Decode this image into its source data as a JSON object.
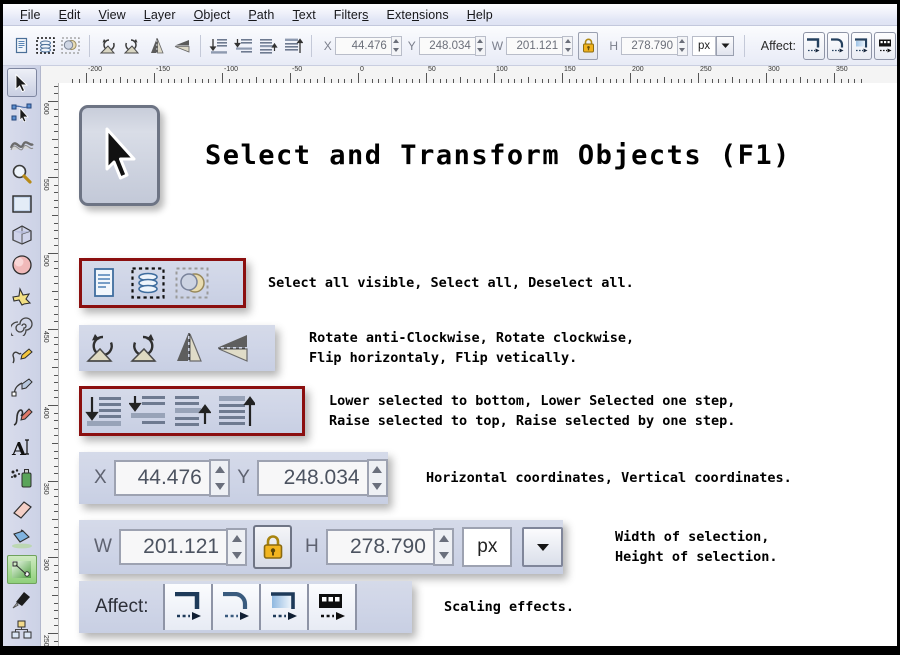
{
  "menu": {
    "items": [
      {
        "label": "File",
        "accel": "F"
      },
      {
        "label": "Edit",
        "accel": "E"
      },
      {
        "label": "View",
        "accel": "V"
      },
      {
        "label": "Layer",
        "accel": "L"
      },
      {
        "label": "Object",
        "accel": "O"
      },
      {
        "label": "Path",
        "accel": "P"
      },
      {
        "label": "Text",
        "accel": "T"
      },
      {
        "label": "Filters",
        "accel": "s"
      },
      {
        "label": "Extensions",
        "accel": "n"
      },
      {
        "label": "Help",
        "accel": "H"
      }
    ]
  },
  "toolbar": {
    "select_all_visible_icon": "document-icon",
    "select_all_icon": "layers-dashed-icon",
    "deselect_all_icon": "deselect-dashed-icon",
    "rotate_ccw_icon": "rotate-counterclockwise-icon",
    "rotate_cw_icon": "rotate-clockwise-icon",
    "flip_h_icon": "flip-horizontal-icon",
    "flip_v_icon": "flip-vertical-icon",
    "lower_to_bottom_icon": "lower-to-bottom-icon",
    "lower_one_icon": "lower-one-step-icon",
    "raise_one_icon": "raise-one-step-icon",
    "raise_to_top_icon": "raise-to-top-icon",
    "x_label": "X",
    "x_value": "44.476",
    "y_label": "Y",
    "y_value": "248.034",
    "w_label": "W",
    "w_value": "201.121",
    "lock_icon": "padlock-icon",
    "h_label": "H",
    "h_value": "278.790",
    "unit_value": "px",
    "unit_dropdown_icon": "chevron-down-icon",
    "affect_label": "Affect:",
    "affect_buttons": [
      "scale-stroke-width-icon",
      "scale-rounded-corners-icon",
      "move-gradients-icon",
      "move-patterns-icon"
    ]
  },
  "rulers": {
    "horizontal_ticks": [
      "-200",
      "-150",
      "-100",
      "-50",
      "0",
      "50",
      "100",
      "150",
      "200",
      "250",
      "300",
      "350"
    ],
    "vertical_ticks": [
      "600",
      "550",
      "500",
      "450",
      "400",
      "350",
      "300",
      "250"
    ],
    "unit": "px"
  },
  "toolbox": {
    "tools": [
      {
        "name": "selector-tool",
        "icon": "arrow-cursor-icon",
        "state": "active"
      },
      {
        "name": "node-editor-tool",
        "icon": "node-editor-icon",
        "state": "normal"
      },
      {
        "name": "tweak-tool",
        "icon": "tweak-wave-icon",
        "state": "normal"
      },
      {
        "name": "zoom-tool",
        "icon": "magnifier-icon",
        "state": "normal"
      },
      {
        "name": "rectangle-tool",
        "icon": "rectangle-icon",
        "state": "normal"
      },
      {
        "name": "3d-box-tool",
        "icon": "cube-icon",
        "state": "normal"
      },
      {
        "name": "ellipse-tool",
        "icon": "ellipse-icon",
        "state": "normal"
      },
      {
        "name": "star-tool",
        "icon": "star-icon",
        "state": "normal"
      },
      {
        "name": "spiral-tool",
        "icon": "spiral-icon",
        "state": "normal"
      },
      {
        "name": "pencil-tool",
        "icon": "pencil-freehand-icon",
        "state": "normal"
      },
      {
        "name": "bezier-tool",
        "icon": "bezier-pen-icon",
        "state": "normal"
      },
      {
        "name": "calligraphy-tool",
        "icon": "calligraphy-pen-icon",
        "state": "normal"
      },
      {
        "name": "text-tool",
        "icon": "text-a-icon",
        "state": "normal"
      },
      {
        "name": "spray-tool",
        "icon": "spray-can-icon",
        "state": "normal"
      },
      {
        "name": "eraser-tool",
        "icon": "eraser-icon",
        "state": "normal"
      },
      {
        "name": "paint-bucket-tool",
        "icon": "paint-bucket-icon",
        "state": "normal"
      },
      {
        "name": "gradient-tool",
        "icon": "gradient-icon",
        "state": "selected"
      },
      {
        "name": "dropper-tool",
        "icon": "eyedropper-icon",
        "state": "normal"
      },
      {
        "name": "connector-tool",
        "icon": "connector-icon",
        "state": "normal"
      }
    ]
  },
  "document": {
    "title": "Select and Transform Objects (F1)",
    "cursor_icon": "arrow-cursor-icon",
    "groups": [
      {
        "id": "selection-group",
        "highlighted": true,
        "icons": [
          "document-icon",
          "layers-dashed-icon",
          "deselect-dashed-icon"
        ],
        "caption": [
          "Select all visible, Select all, Deselect all."
        ]
      },
      {
        "id": "rotate-flip-group",
        "highlighted": false,
        "icons": [
          "rotate-counterclockwise-icon",
          "rotate-clockwise-icon",
          "flip-horizontal-icon",
          "flip-vertical-icon"
        ],
        "caption": [
          "Rotate anti-Clockwise, Rotate clockwise,",
          "Flip horizontaly, Flip vetically."
        ]
      },
      {
        "id": "z-order-group",
        "highlighted": true,
        "icons": [
          "lower-to-bottom-icon",
          "lower-one-step-icon",
          "raise-one-step-icon",
          "raise-to-top-icon"
        ],
        "caption": [
          "Lower selected to bottom, Lower Selected one step,",
          "Raise selected to top, Raise selected by one step."
        ]
      },
      {
        "id": "coordinates-group",
        "highlighted": false,
        "x_label": "X",
        "x_value": "44.476",
        "y_label": "Y",
        "y_value": "248.034",
        "caption": [
          "Horizontal coordinates, Vertical coordinates."
        ]
      },
      {
        "id": "dimensions-group",
        "highlighted": false,
        "w_label": "W",
        "w_value": "201.121",
        "lock_icon": "padlock-icon",
        "h_label": "H",
        "h_value": "278.790",
        "unit_value": "px",
        "caption": [
          "Width of selection,",
          "Height of selection."
        ]
      },
      {
        "id": "affect-group",
        "highlighted": false,
        "affect_label": "Affect:",
        "icons": [
          "scale-stroke-width-icon",
          "scale-rounded-corners-icon",
          "move-gradients-icon",
          "move-patterns-icon"
        ],
        "caption": [
          "Scaling effects."
        ]
      }
    ]
  },
  "colors": {
    "highlight_border": "#8b0f0f",
    "panel_bg": "#d0d6e8",
    "toolbar_bg": "#eef0fa",
    "canvas_bg": "#ffffff",
    "window_border": "#000000"
  }
}
